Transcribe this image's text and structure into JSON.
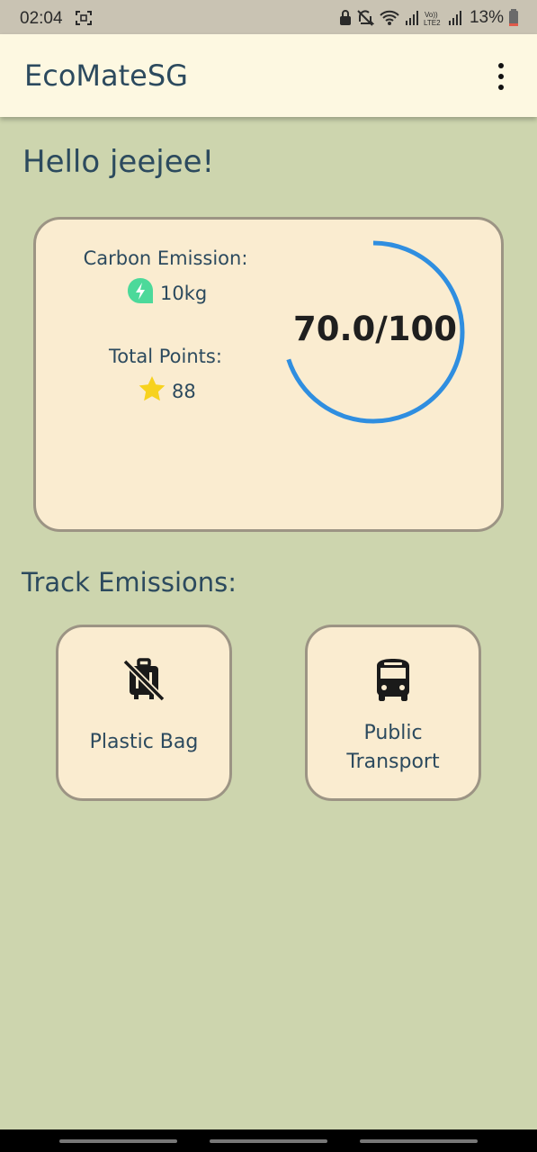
{
  "status_bar": {
    "time": "02:04",
    "battery": "13%",
    "icons": [
      "screenshot-icon",
      "lock-icon",
      "mute-icon",
      "wifi-icon",
      "signal-icon",
      "volte-icon",
      "signal-icon",
      "battery-icon"
    ]
  },
  "app_bar": {
    "title": "EcoMateSG",
    "menu_icon": "more-vert-icon"
  },
  "greeting": "Hello jeejee!",
  "stats": {
    "carbon_label": "Carbon Emission:",
    "carbon_value": "10kg",
    "carbon_icon": "bolt-icon",
    "points_label": "Total Points:",
    "points_value": "88",
    "points_icon": "star-icon",
    "score_text": "70.0/100",
    "score_fraction": 0.7,
    "ring_color": "#2f8ee0"
  },
  "track": {
    "title": "Track Emissions:",
    "buttons": [
      {
        "label": "Plastic Bag",
        "icon": "no-luggage-icon"
      },
      {
        "label": "Public\nTransport",
        "icon": "bus-icon"
      }
    ]
  },
  "colors": {
    "background": "#cdd5ae",
    "app_bar": "#fdf8e1",
    "card": "#faecd0",
    "text": "#2c4a5e",
    "accent_green": "#4cd99a",
    "star": "#f7d21e"
  }
}
